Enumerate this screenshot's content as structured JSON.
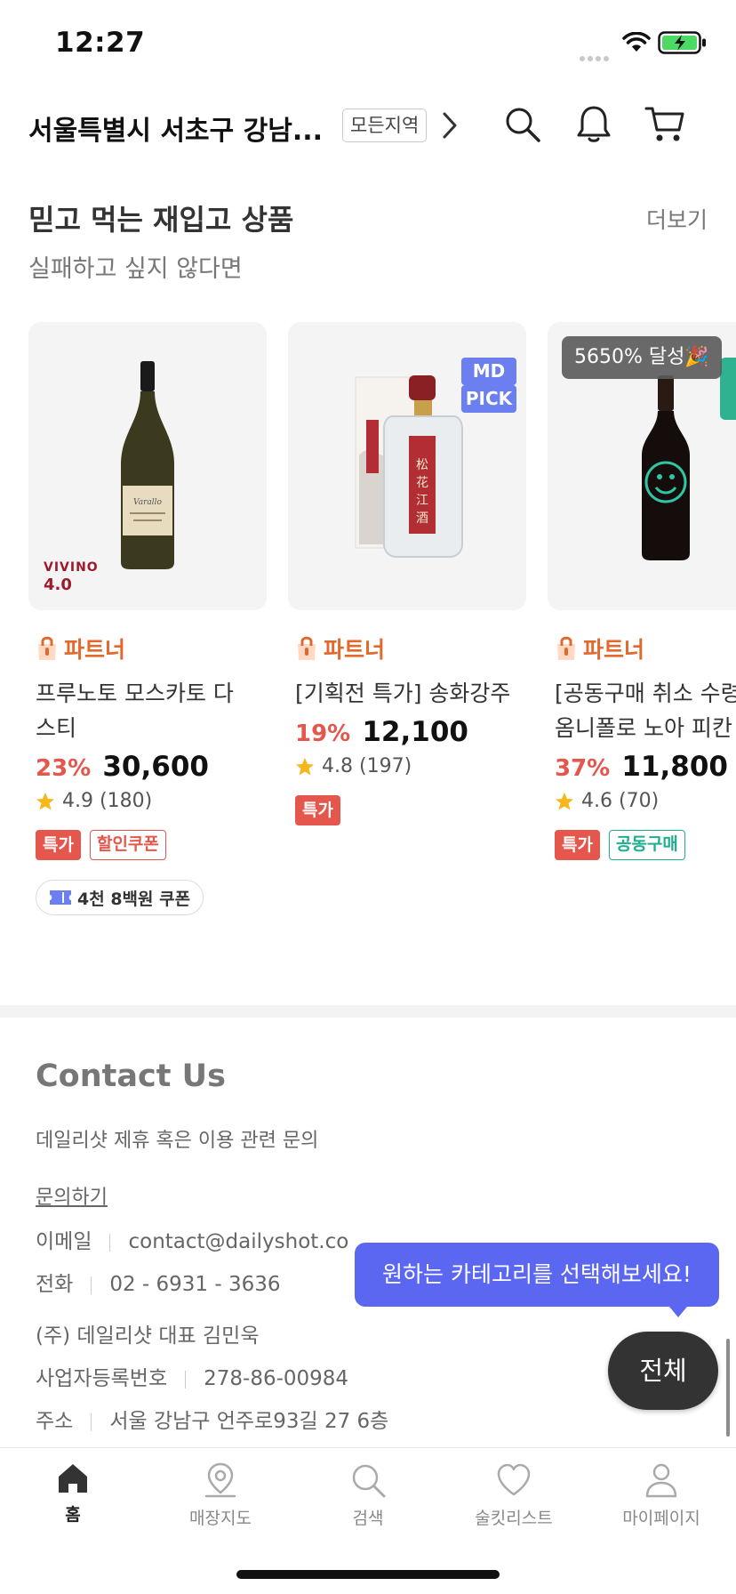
{
  "status_bar": {
    "time": "12:27"
  },
  "header": {
    "location": "서울특별시 서초구 강남...",
    "region_button": "모든지역"
  },
  "section": {
    "title": "믿고 먹는 재입고 상품",
    "subtitle": "실패하고 싶지 않다면",
    "more": "더보기"
  },
  "products": [
    {
      "partner": "파트너",
      "name_line1": "프루노토 모스카토 다",
      "name_line2": "스티",
      "discount": "23%",
      "price": "30,600",
      "rating": "4.9",
      "reviews": "(180)",
      "tag1": "특가",
      "tag2": "할인쿠폰",
      "coupon": "4천 8백원 쿠폰",
      "vivino_label": "VIVINO",
      "vivino_score": "4.0"
    },
    {
      "partner": "파트너",
      "name_line1": "[기획전 특가] 송화강주",
      "discount": "19%",
      "price": "12,100",
      "rating": "4.8",
      "reviews": "(197)",
      "tag1": "특가",
      "badge_line1": "MD",
      "badge_line2": "PICK"
    },
    {
      "partner": "파트너",
      "name_line1": "[공동구매 취소 수령",
      "name_line2": "옴니폴로 노아 피칸",
      "discount": "37%",
      "price": "11,800",
      "rating": "4.6",
      "reviews": "(70)",
      "tag1": "특가",
      "tag2": "공동구매",
      "achievement": "5650% 달성🎉"
    }
  ],
  "contact": {
    "title": "Contact Us",
    "description": "데일리샷 제휴 혹은 이용 관련 문의",
    "inquiry_link": "문의하기",
    "email_label": "이메일",
    "email_value": "contact@dailyshot.co",
    "phone_label": "전화",
    "phone_value": "02 - 6931 - 3636",
    "company": "(주) 데일리샷 대표 김민욱",
    "biz_label": "사업자등록번호",
    "biz_value": "278-86-00984",
    "addr_label": "주소",
    "addr_value": "서울 강남구 언주로93길 27 6층"
  },
  "tooltip": "원하는 카테고리를 선택해보세요!",
  "fab": "전체",
  "tabs": [
    {
      "label": "홈",
      "icon": "home-icon"
    },
    {
      "label": "매장지도",
      "icon": "map-pin-icon"
    },
    {
      "label": "검색",
      "icon": "search-icon"
    },
    {
      "label": "술킷리스트",
      "icon": "heart-icon"
    },
    {
      "label": "마이페이지",
      "icon": "person-icon"
    }
  ],
  "colors": {
    "accent_orange": "#e1692d",
    "discount_red": "#e5574c",
    "tooltip_blue": "#5b67f0",
    "md_badge": "#6b7ff0",
    "teal": "#1fae8f"
  }
}
